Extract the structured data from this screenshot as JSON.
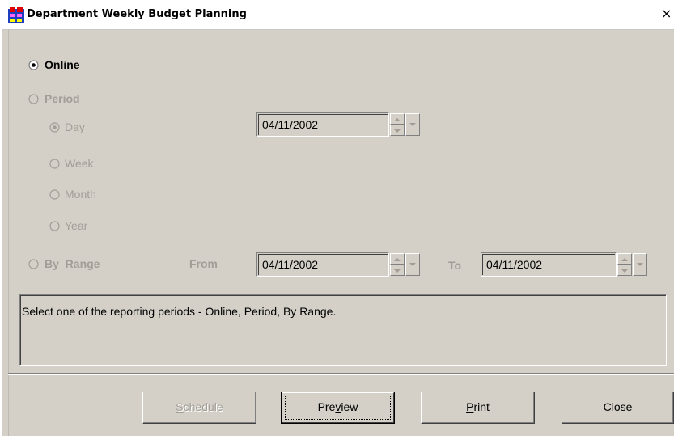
{
  "window": {
    "title": "Department Weekly Budget Planning",
    "close_glyph": "×"
  },
  "options": {
    "online": "Online",
    "period": "Period",
    "day": "Day",
    "week": "Week",
    "month": "Month",
    "year": "Year",
    "by_range": "By  Range",
    "from_label": "From",
    "to_label": "To"
  },
  "dates": {
    "day_date": "04/11/2002",
    "from_date": "04/11/2002",
    "to_date": "04/11/2002"
  },
  "message": "Select one of the reporting periods - Online, Period, By Range.",
  "buttons": {
    "schedule_pre": "",
    "schedule_u": "S",
    "schedule_post": "chedule",
    "preview_pre": "Pre",
    "preview_u": "v",
    "preview_post": "iew",
    "print_pre": "",
    "print_u": "P",
    "print_post": "rint",
    "close": "Close"
  },
  "icons": {
    "app": "app-window-icon",
    "close": "close-icon",
    "spin": "spin-updown-icon",
    "dropdown": "chevron-down-icon"
  },
  "selection": {
    "report_type": "online",
    "period_sub": "day"
  }
}
